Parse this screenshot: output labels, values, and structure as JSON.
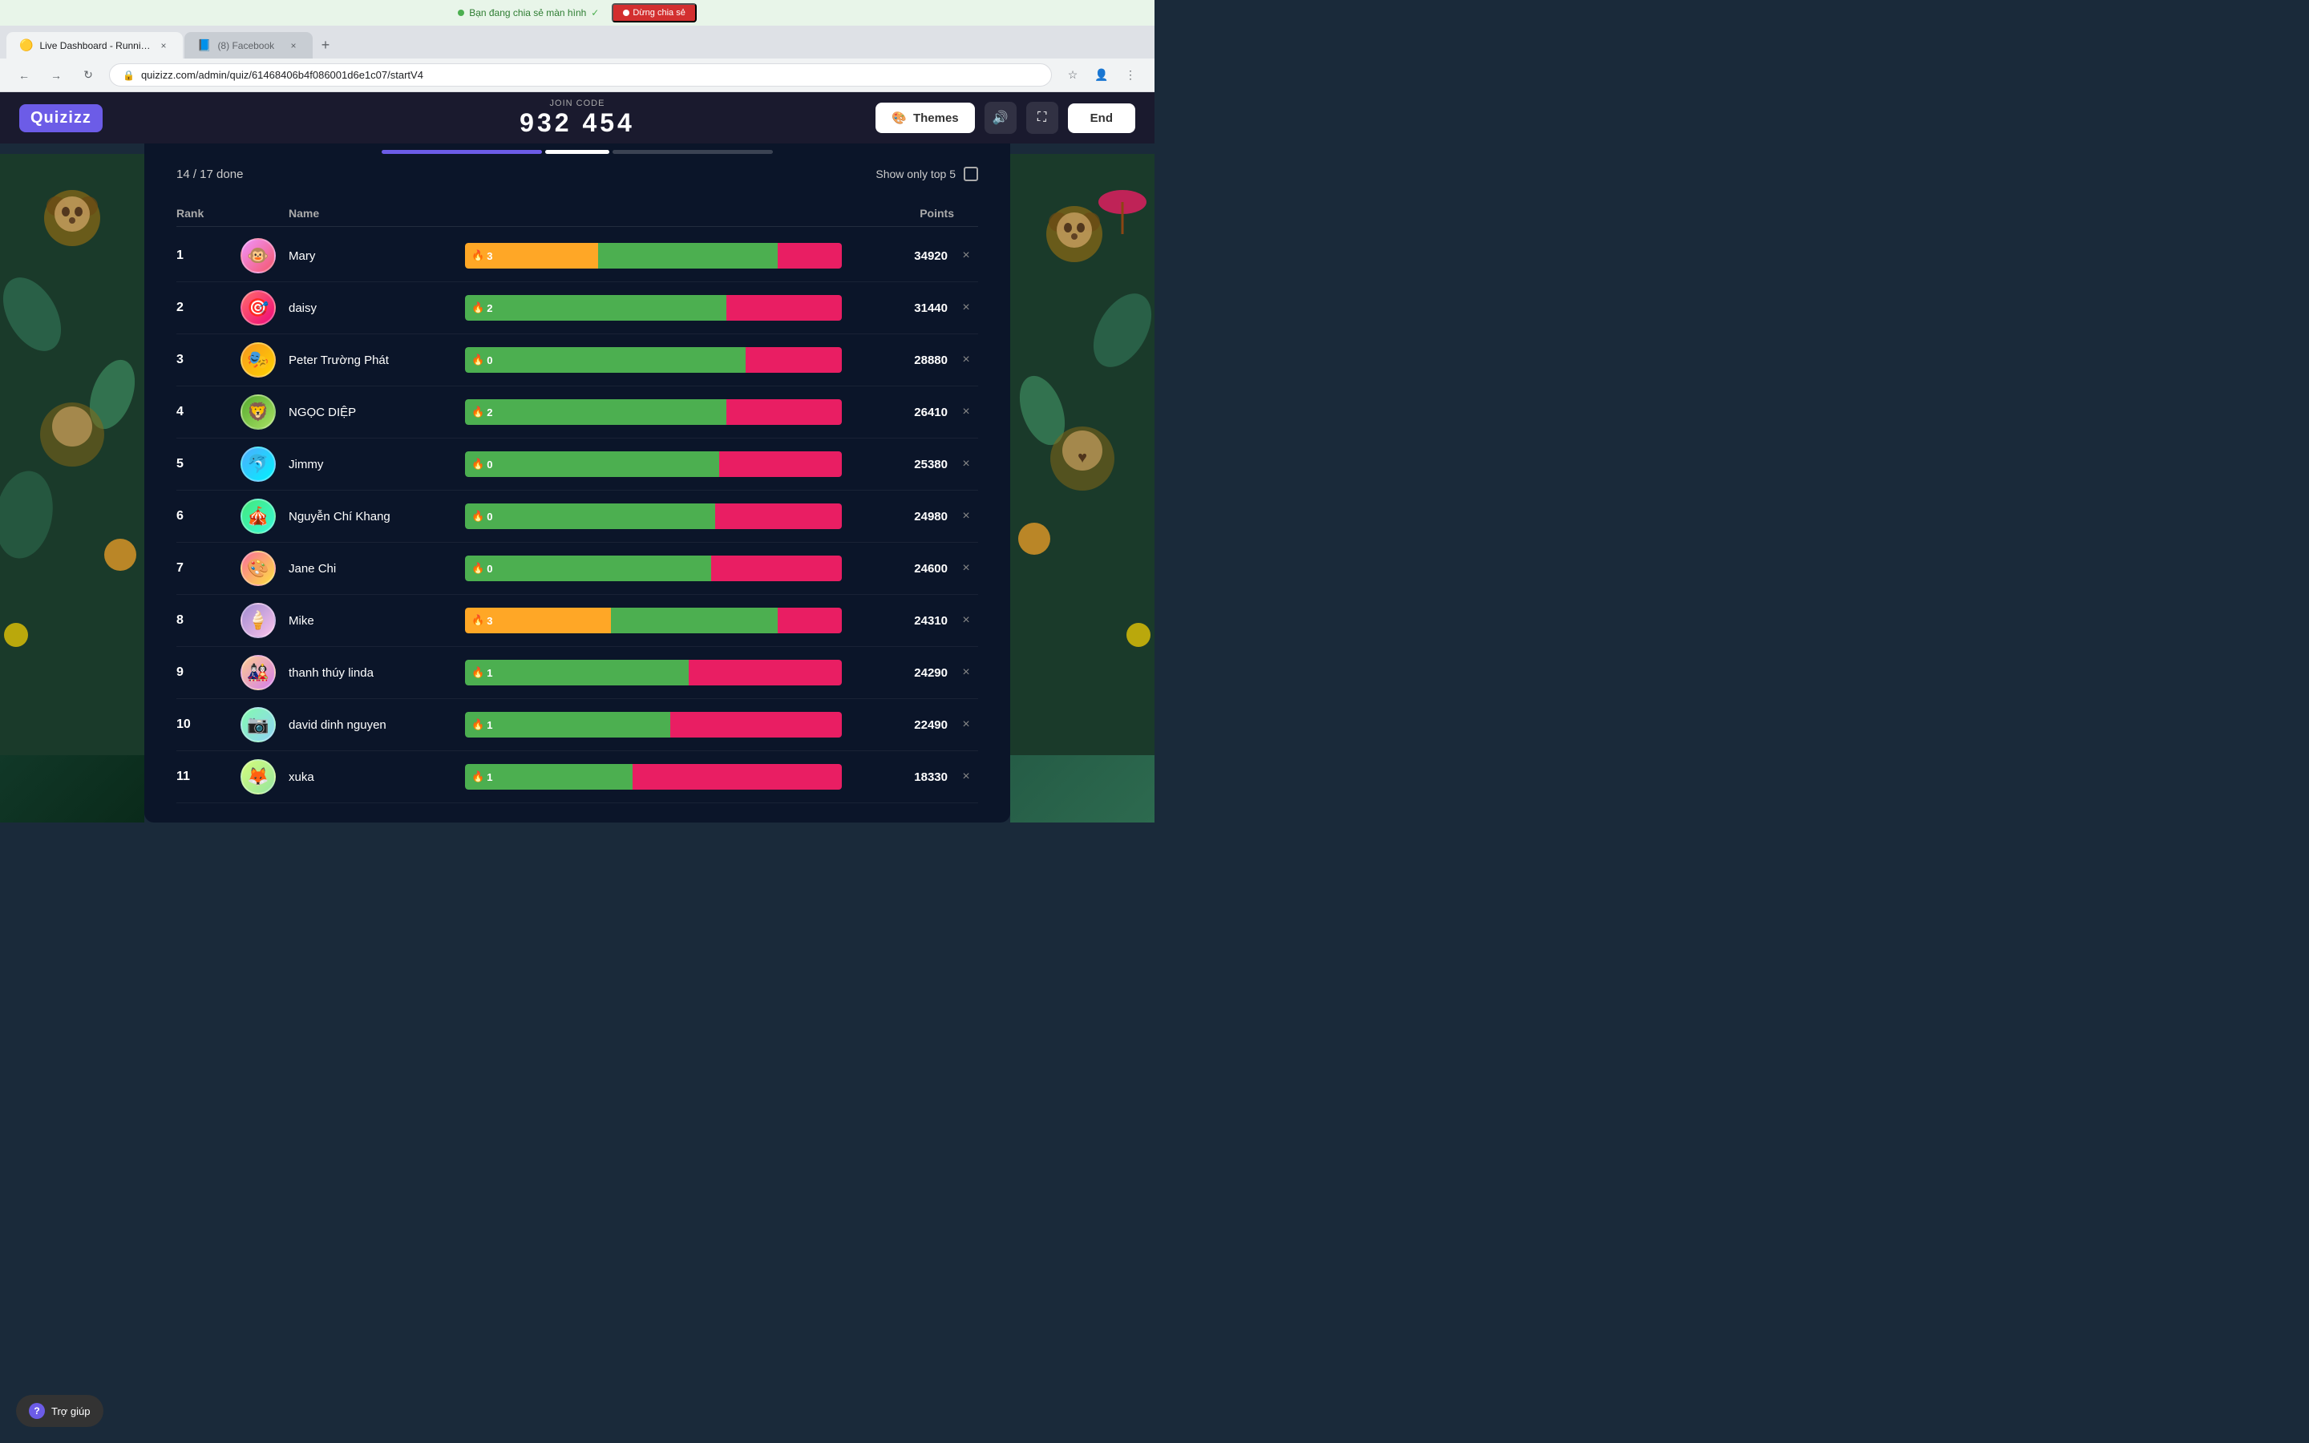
{
  "browser": {
    "tabs": [
      {
        "id": "tab1",
        "label": "Live Dashboard - Running",
        "active": true,
        "favicon": "🟡"
      },
      {
        "id": "tab2",
        "label": "(8) Facebook",
        "active": false,
        "favicon": "📘"
      }
    ],
    "url": "quizizz.com/admin/quiz/61468406b4f086001d6e1c07/startV4",
    "new_tab_label": "+"
  },
  "screen_share": {
    "active_text": "Bạn đang chia sẻ màn hình",
    "stop_text": "Dừng chia sẻ",
    "check_icon": "✓",
    "dot_icon": "■"
  },
  "header": {
    "logo": "Quizizz",
    "join_code_label": "JOIN CODE",
    "join_code": "932 454",
    "themes_label": "Themes",
    "end_label": "End"
  },
  "leaderboard": {
    "progress_text": "14 / 17 done",
    "show_top5_label": "Show only top 5",
    "columns": {
      "rank": "Rank",
      "name": "Name",
      "points": "Points"
    },
    "players": [
      {
        "rank": 1,
        "name": "Mary",
        "streak": 3,
        "streak_color": "orange",
        "green_pct": 55,
        "orange_pct": 30,
        "points": 34920,
        "avatar": "🐵"
      },
      {
        "rank": 2,
        "name": "daisy",
        "streak": 2,
        "streak_color": "green",
        "green_pct": 60,
        "orange_pct": 0,
        "points": 31440,
        "avatar": "🎯"
      },
      {
        "rank": 3,
        "name": "Peter Trường Phát",
        "streak": 0,
        "streak_color": "green",
        "green_pct": 65,
        "orange_pct": 0,
        "points": 28880,
        "avatar": "🎭"
      },
      {
        "rank": 4,
        "name": "NGỌC DIỆP",
        "streak": 2,
        "streak_color": "green",
        "green_pct": 60,
        "orange_pct": 0,
        "points": 26410,
        "avatar": "🦁"
      },
      {
        "rank": 5,
        "name": "Jimmy",
        "streak": 0,
        "streak_color": "green",
        "green_pct": 58,
        "orange_pct": 0,
        "points": 25380,
        "avatar": "🐬"
      },
      {
        "rank": 6,
        "name": "Nguyễn Chí Khang",
        "streak": 0,
        "streak_color": "green",
        "green_pct": 57,
        "orange_pct": 0,
        "points": 24980,
        "avatar": "🎪"
      },
      {
        "rank": 7,
        "name": "Jane Chi",
        "streak": 0,
        "streak_color": "green",
        "green_pct": 56,
        "orange_pct": 0,
        "points": 24600,
        "avatar": "🎨"
      },
      {
        "rank": 8,
        "name": "Mike",
        "streak": 3,
        "streak_color": "orange",
        "green_pct": 45,
        "orange_pct": 30,
        "points": 24310,
        "avatar": "🍦"
      },
      {
        "rank": 9,
        "name": "thanh thúy linda",
        "streak": 1,
        "streak_color": "green",
        "green_pct": 50,
        "orange_pct": 0,
        "points": 24290,
        "avatar": "🎎"
      },
      {
        "rank": 10,
        "name": "david dinh nguyen",
        "streak": 1,
        "streak_color": "green",
        "green_pct": 45,
        "orange_pct": 0,
        "points": 22490,
        "avatar": "📷"
      },
      {
        "rank": 11,
        "name": "xuka",
        "streak": 1,
        "streak_color": "green",
        "green_pct": 35,
        "orange_pct": 0,
        "points": 18330,
        "avatar": "🦊"
      }
    ]
  },
  "help": {
    "label": "Trợ giúp"
  },
  "colors": {
    "green_bar": "#4caf50",
    "orange_bar": "#ffa726",
    "red_bar": "#e91e63",
    "header_bg": "#1a1a2e",
    "panel_bg": "rgba(10,20,40,0.92)"
  }
}
